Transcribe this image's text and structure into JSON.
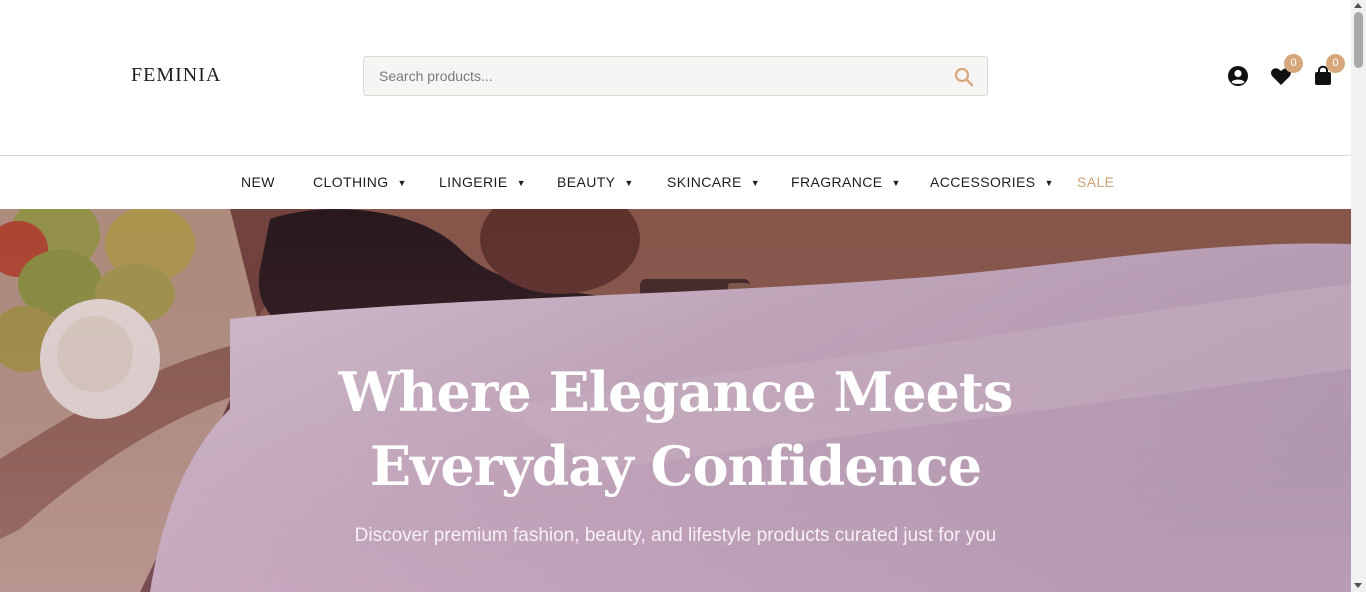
{
  "header": {
    "logo": "FEMINIA",
    "search": {
      "placeholder": "Search products...",
      "icon": "search-icon"
    },
    "icons": [
      {
        "name": "account-icon"
      },
      {
        "name": "wishlist-heart-icon",
        "badge": "0"
      },
      {
        "name": "cart-bag-icon",
        "badge": "0"
      }
    ]
  },
  "nav": {
    "items": [
      {
        "label": "NEW",
        "has_dropdown": false
      },
      {
        "label": "CLOTHING",
        "has_dropdown": true
      },
      {
        "label": "LINGERIE",
        "has_dropdown": true
      },
      {
        "label": "BEAUTY",
        "has_dropdown": true
      },
      {
        "label": "SKINCARE",
        "has_dropdown": true
      },
      {
        "label": "FRAGRANCE",
        "has_dropdown": true
      },
      {
        "label": "ACCESSORIES",
        "has_dropdown": true
      },
      {
        "label": "SALE",
        "has_dropdown": false
      }
    ],
    "caret": "▼"
  },
  "hero": {
    "title_line1": "Where Elegance Meets",
    "title_line2": "Everyday Confidence",
    "subtitle": "Discover premium fashion, beauty, and lifestyle products curated just for you"
  },
  "colors": {
    "accent": "#d7a77b",
    "sale": "#cc9f73",
    "text": "#1e1e1e",
    "hero_overlay": "#b88aa4"
  }
}
